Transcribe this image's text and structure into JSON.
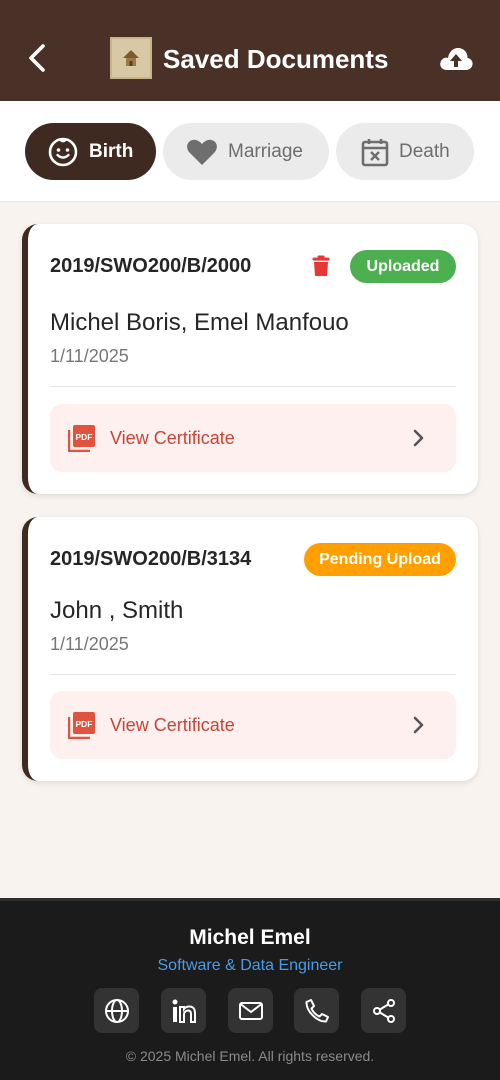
{
  "header": {
    "title": "Saved Documents",
    "icons": {
      "back": "arrow-left-icon",
      "logo": "app-logo",
      "upload": "cloud-upload-icon"
    }
  },
  "tabs": [
    {
      "label": "Birth",
      "icon": "baby-face-icon",
      "active": true
    },
    {
      "label": "Marriage",
      "icon": "heart-icon",
      "active": false
    },
    {
      "label": "Death",
      "icon": "calendar-x-icon",
      "active": false
    }
  ],
  "documents": [
    {
      "reg_no": "2019/SWO200/B/2000",
      "status": "Uploaded",
      "status_color": "#4caf50",
      "name": "Michel Boris, Emel Manfouo",
      "date": "1/11/2025",
      "action_label": "View Certificate",
      "has_delete": true
    },
    {
      "reg_no": "2019/SWO200/B/3134",
      "status": "Pending Upload",
      "status_color": "#ffa000",
      "name": "John , Smith",
      "date": "1/11/2025",
      "action_label": "View Certificate",
      "has_delete": false
    }
  ],
  "footer": {
    "name": "Michel Emel",
    "role": "Software & Data Engineer",
    "social_icons": [
      "globe-icon",
      "linkedin-icon",
      "mail-icon",
      "phone-icon",
      "share-icon"
    ],
    "copyright": "© 2025 Michel Emel. All rights reserved."
  },
  "colors": {
    "primary": "#4a3128",
    "accent_red": "#c74537",
    "background": "#f8f3ef"
  }
}
